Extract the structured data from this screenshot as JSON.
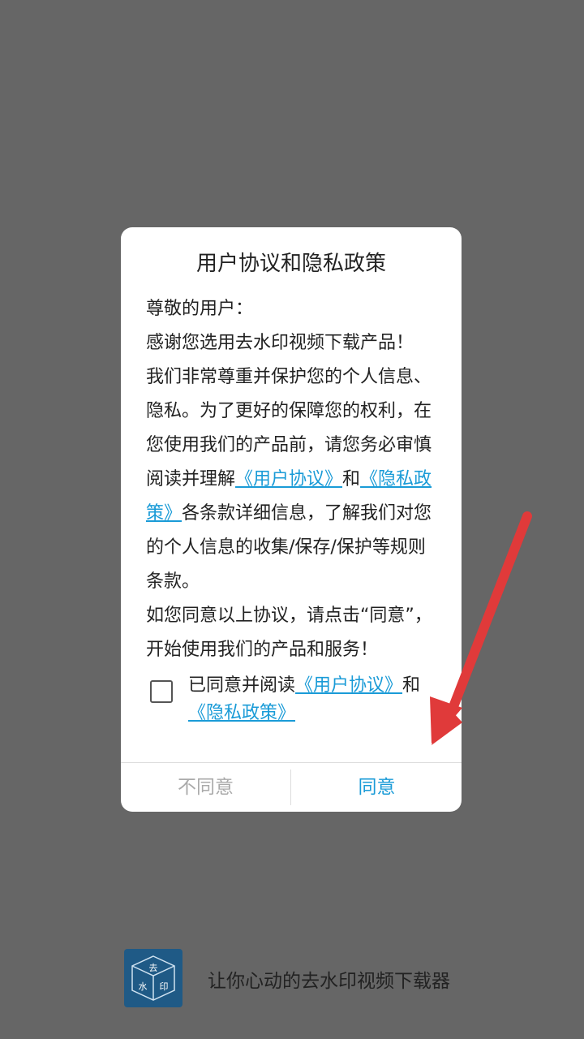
{
  "dialog": {
    "title": "用户协议和隐私政策",
    "greeting": "尊敬的用户：",
    "thanks": "感谢您选用去水印视频下载产品！",
    "para_1": "我们非常尊重并保护您的个人信息、隐私。为了更好的保障您的权利，在您使用我们的产品前，请您务必审慎阅读并理解",
    "link_user_agreement": "《用户协议》",
    "and": "和",
    "link_privacy_policy": "《隐私政策》",
    "para_2": "各条款详细信息，了解我们对您的个人信息的收集/保存/保护等规则条款。",
    "para_3": "如您同意以上协议，请点击“同意”，开始使用我们的产品和服务！",
    "checkbox_text": "已同意并阅读",
    "checkbox_link_user_agreement": "《用户协议》",
    "checkbox_and": "和",
    "checkbox_link_privacy_policy": "《隐私政策》",
    "checkbox_checked": false,
    "disagree_label": "不同意",
    "agree_label": "同意"
  },
  "brand": {
    "slogan": "让你心动的去水印视频下载器",
    "logo_chars": [
      "去",
      "水",
      "印"
    ]
  },
  "colors": {
    "overlay": "#666666",
    "link": "#1a9bd7",
    "arrow": "#e03a3a",
    "logo_bg": "#1f5a86"
  },
  "icons": {
    "arrow": "red-arrow-icon",
    "logo": "watermark-cube-logo-icon"
  }
}
